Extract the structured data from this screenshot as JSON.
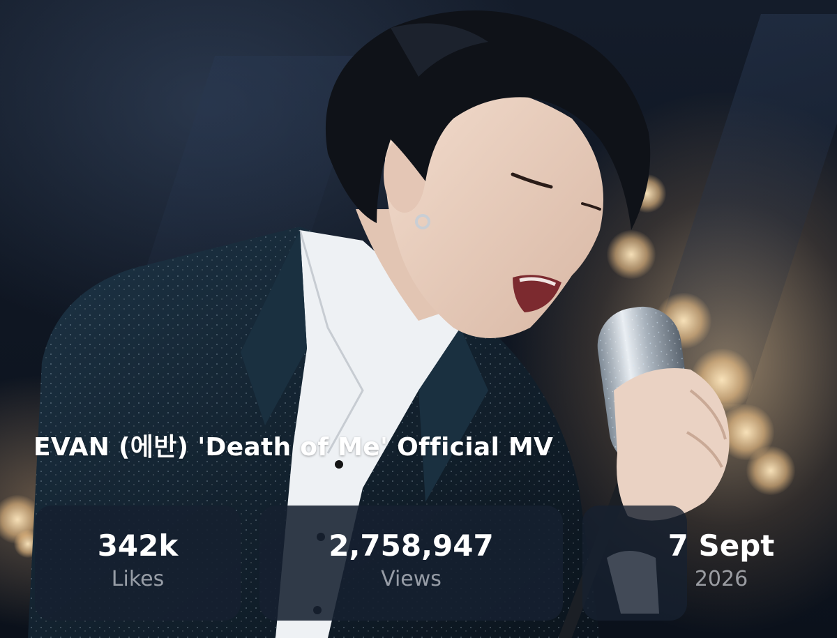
{
  "video": {
    "title": "EVAN (에반) 'Death of Me' Official MV"
  },
  "stats": {
    "likes": {
      "value": "342k",
      "label": "Likes"
    },
    "views": {
      "value": "2,758,947",
      "label": "Views"
    },
    "date": {
      "value": "7 Sept",
      "label": "2026"
    }
  },
  "colors": {
    "card_background": "#162030",
    "text_primary": "#ffffff",
    "text_secondary": "#a9aeb6"
  }
}
